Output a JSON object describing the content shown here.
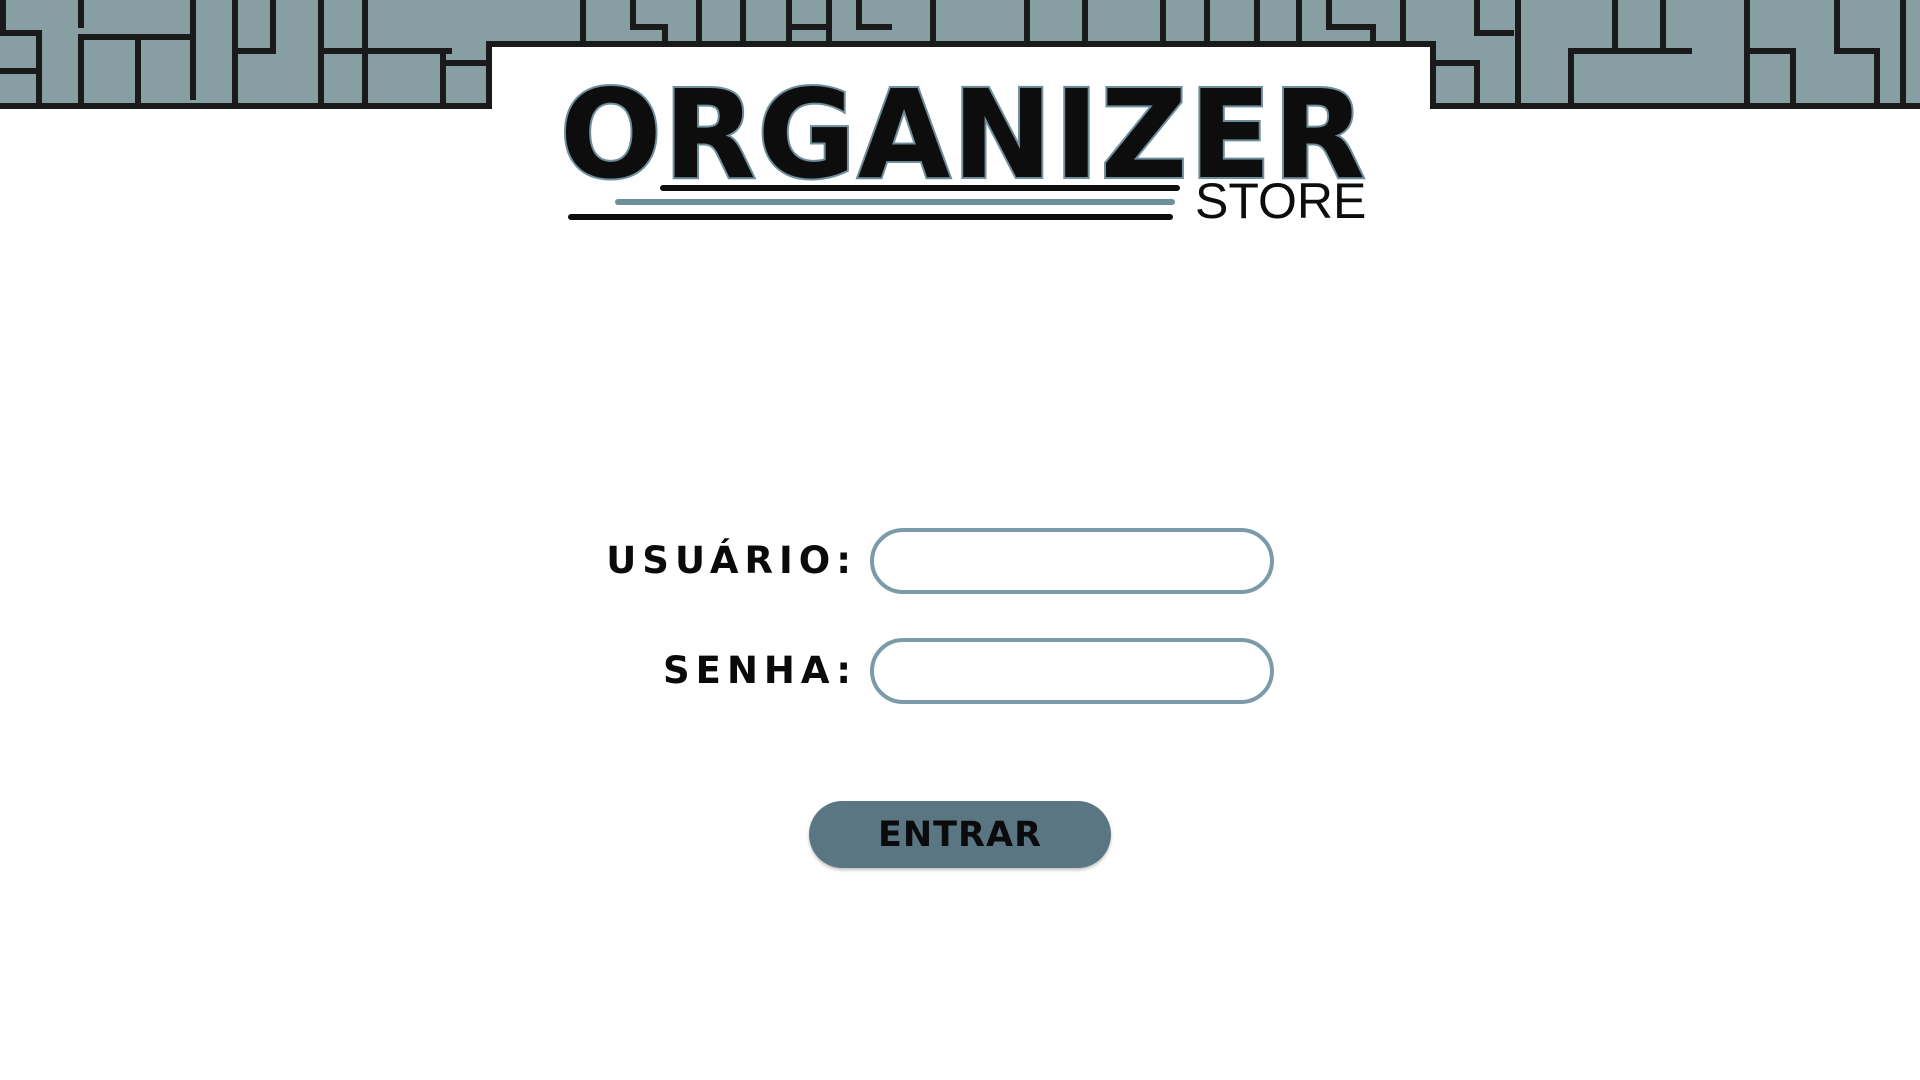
{
  "theme": {
    "banner_color": "#879ea3",
    "banner_line_color": "#1a1a1a",
    "accent_color": "#7a9ba7",
    "button_color": "#5a7682",
    "background": "#ffffff"
  },
  "logo": {
    "word": "ORGANIZER",
    "subtitle": "STORE"
  },
  "login_form": {
    "username": {
      "label": "USUÁRIO:",
      "value": "",
      "placeholder": ""
    },
    "password": {
      "label": "SENHA:",
      "value": "",
      "placeholder": ""
    },
    "submit_label": "ENTRAR"
  }
}
